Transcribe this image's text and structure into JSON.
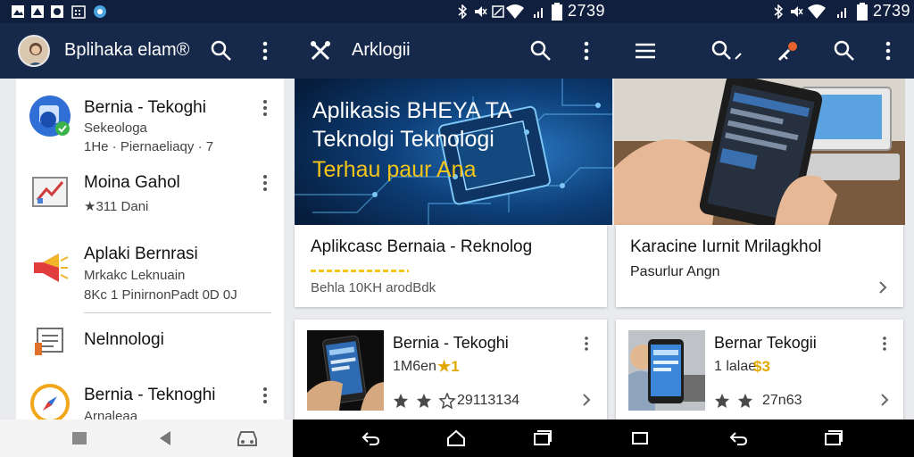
{
  "status_bar": {
    "time_center": "2739",
    "time_right": "2739",
    "icons_left": [
      "image-icon",
      "photo-icon",
      "circle-icon",
      "calendar-icon",
      "app-icon"
    ],
    "icons_right": [
      "bluetooth-icon",
      "mute-icon",
      "wifi-icon",
      "signal-icon",
      "battery-icon"
    ]
  },
  "app_bar": {
    "left_title": "Bplihaka elam®",
    "center_title": "Arklogii",
    "icons": [
      "avatar",
      "search-icon",
      "more-icon",
      "tools-icon",
      "search-icon",
      "more-icon",
      "menu-icon",
      "search-icon",
      "brush-icon",
      "search-icon",
      "more-icon"
    ]
  },
  "list": {
    "items": [
      {
        "title": "Bernia - Tekoghi",
        "line2": "Sekeologa",
        "line3": "1He · Piernaeliaqy · 7"
      },
      {
        "title": "Moina Gahol",
        "line2": "★311 Dani"
      },
      {
        "title": "Aplaki Bernrasi",
        "line2": "Mrkakc Leknuain",
        "line3": "8Kc 1 PinirnonPadt 0D 0J"
      },
      {
        "title": "Nelnnologi"
      },
      {
        "title": "Bernia - Teknoghi",
        "line2": "Arnaleaa"
      }
    ]
  },
  "hero": {
    "line1": "Aplikasis BHEYA TA",
    "line2": "Teknolgi Teknologi",
    "line3": "Terhau paur Ana"
  },
  "card_main": {
    "title": "Aplikcasc Bernaia - Reknolog",
    "sub": "Behla 10KH arodBdk"
  },
  "card_right": {
    "title": "Karacine Iurnit Mrilagkhol",
    "sub": "Pasurlur Angn"
  },
  "card_small_1": {
    "title": "Bernia - Tekoghi",
    "sub": "1M6en",
    "badge": "★1",
    "rating": "29113134"
  },
  "card_small_2": {
    "title": "Bernar Tekogii",
    "sub": "1 lalae",
    "badge": "$3",
    "rating": "27n63"
  },
  "colors": {
    "statusbar": "#0f1f3d",
    "appbar": "#16294a",
    "accent_yellow": "#f5c518",
    "hero_blue": "#0b3a6b"
  }
}
